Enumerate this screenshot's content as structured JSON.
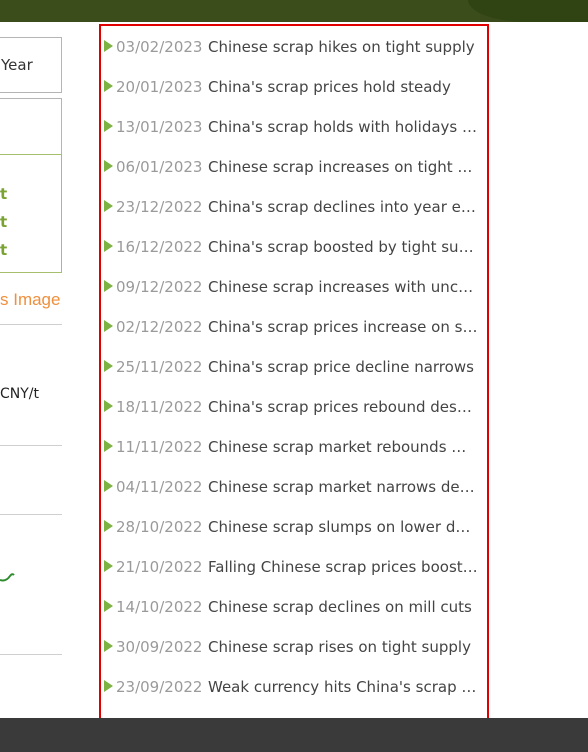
{
  "sidebar": {
    "period_label": "Year",
    "tick_marks": [
      "t",
      "t",
      "t"
    ],
    "image_link": "s Image",
    "unit": "CNY/t"
  },
  "news": {
    "items": [
      {
        "date": "03/02/2023",
        "title": "Chinese scrap hikes on tight supply"
      },
      {
        "date": "20/01/2023",
        "title": "China's scrap prices hold steady"
      },
      {
        "date": "13/01/2023",
        "title": "China's scrap holds with holidays a..."
      },
      {
        "date": "06/01/2023",
        "title": "Chinese scrap increases on tight s..."
      },
      {
        "date": "23/12/2022",
        "title": "China's scrap declines into year end"
      },
      {
        "date": "16/12/2022",
        "title": "China's scrap boosted by tight sup..."
      },
      {
        "date": "09/12/2022",
        "title": "Chinese scrap increases with uncer..."
      },
      {
        "date": "02/12/2022",
        "title": "China's scrap prices increase on sl..."
      },
      {
        "date": "25/11/2022",
        "title": "China's scrap price decline narrows"
      },
      {
        "date": "18/11/2022",
        "title": "China's scrap prices rebound despi..."
      },
      {
        "date": "11/11/2022",
        "title": "Chinese scrap market rebounds wi..."
      },
      {
        "date": "04/11/2022",
        "title": "Chinese scrap market narrows decl..."
      },
      {
        "date": "28/10/2022",
        "title": "Chinese scrap slumps on lower de..."
      },
      {
        "date": "21/10/2022",
        "title": "Falling Chinese scrap prices boost ..."
      },
      {
        "date": "14/10/2022",
        "title": "Chinese scrap declines on mill cuts"
      },
      {
        "date": "30/09/2022",
        "title": "Chinese scrap rises on tight supply"
      },
      {
        "date": "23/09/2022",
        "title": "Weak currency hits China's scrap i..."
      }
    ]
  },
  "colors": {
    "highlight_border": "#e00000",
    "bullet": "#7cb342",
    "date": "#9a9a9a",
    "title": "#444444",
    "accent_orange": "#f08f3c"
  }
}
